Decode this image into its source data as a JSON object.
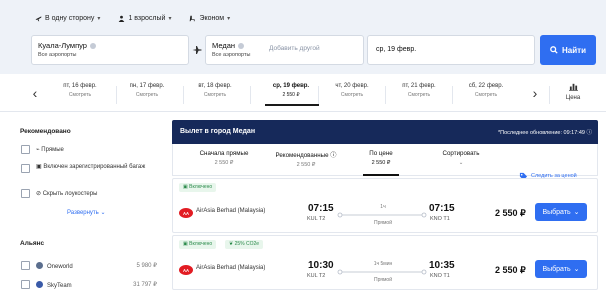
{
  "search": {
    "trip_type": "В одну сторону",
    "passengers": "1 взрослый",
    "cabin": "Эконом",
    "from_city": "Куала-Лумпур",
    "from_sub": "Все аэропорты",
    "to_city": "Медан",
    "to_sub": "Все аэропорты",
    "add_other": "Добавить другой",
    "date": "ср, 19 февр.",
    "find_label": "Найти"
  },
  "dates": [
    {
      "label": "пт, 16 февр.",
      "sub": "Смотреть"
    },
    {
      "label": "пн, 17 февр.",
      "sub": "Смотреть"
    },
    {
      "label": "вт, 18 февр.",
      "sub": "Смотреть"
    },
    {
      "label": "ср, 19 февр.",
      "sub": "2 550 ₽"
    },
    {
      "label": "чт, 20 февр.",
      "sub": "Смотреть"
    },
    {
      "label": "пт, 21 февр.",
      "sub": "Смотреть"
    },
    {
      "label": "сб, 22 февр.",
      "sub": "Смотреть"
    }
  ],
  "price_label": "Цена",
  "filters": {
    "recommended_title": "Рекомендовано",
    "direct": "Прямые",
    "baggage": "Включен зарегистрированный багаж",
    "hide_lowcost": "Скрыть лоукостеры",
    "expand": "Развернуть",
    "alliance_title": "Альянс",
    "oneworld": "Oneworld",
    "oneworld_price": "5 980 ₽",
    "skyteam": "SkyTeam",
    "skyteam_price": "31 797 ₽"
  },
  "results": {
    "title": "Вылет в город Медан",
    "updated": "*Последнее обновление: 09:17:49",
    "tabs": [
      {
        "label": "Сначала прямые",
        "sub": "2 550 ₽"
      },
      {
        "label": "Рекомендованные",
        "sub": "2 550 ₽"
      },
      {
        "label": "По цене",
        "sub": "2 550 ₽"
      },
      {
        "label": "Сортировать",
        "sub": ""
      }
    ],
    "track_label": "Следить за ценой",
    "flights": [
      {
        "badge": "Включено",
        "badge2": "",
        "airline": "AirAsia Berhad (Malaysia)",
        "dep_time": "07:15",
        "dep_code": "KUL T2",
        "duration": "1ч",
        "stops": "Прямой",
        "arr_time": "07:15",
        "arr_code": "KNO T1",
        "price": "2 550 ₽",
        "btn": "Выбрать"
      },
      {
        "badge": "Включено",
        "badge2": "25% CO2e",
        "airline": "AirAsia Berhad (Malaysia)",
        "dep_time": "10:30",
        "dep_code": "KUL T2",
        "duration": "1ч 5мин",
        "stops": "Прямой",
        "arr_time": "10:35",
        "arr_code": "KNO T1",
        "price": "2 550 ₽",
        "btn": "Выбрать"
      }
    ]
  },
  "colors": {
    "accent": "#2f6ef1",
    "header": "#16295a",
    "airasia": "#e21c23"
  }
}
